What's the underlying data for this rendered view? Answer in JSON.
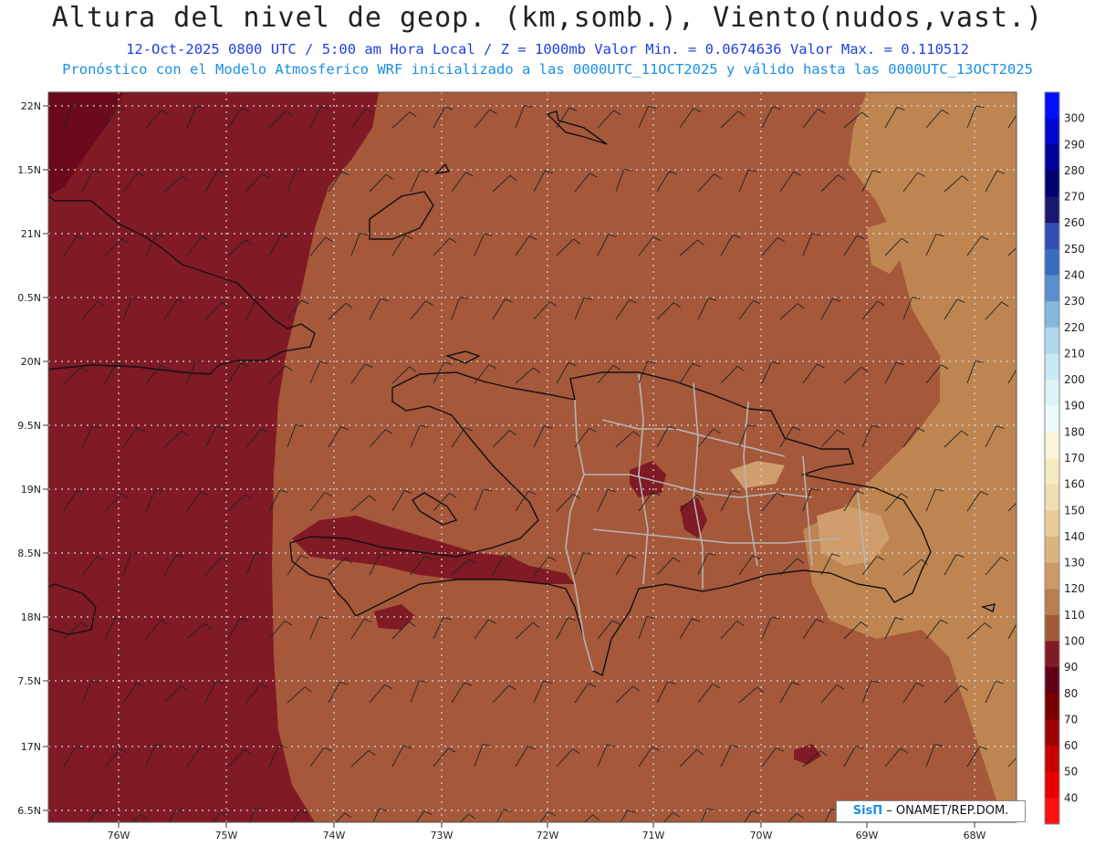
{
  "title": "Altura del nivel de geop. (km,somb.), Viento(nudos,vast.)",
  "subtitle1": "12-Oct-2025  0800 UTC / 5:00 am Hora Local / Z = 1000mb  Valor Min. = 0.0674636  Valor Max. = 0.110512",
  "subtitle2": "Pronóstico con el Modelo Atmosferico WRF inicializado a las 0000UTC_11OCT2025 y válido hasta las  0000UTC_13OCT2025",
  "credit": {
    "brand": "SisΠ",
    "org": " – ONAMET/REP.DOM."
  },
  "lat_labels": [
    "22N",
    "1.5N",
    "21N",
    "0.5N",
    "20N",
    "9.5N",
    "19N",
    "8.5N",
    "18N",
    "7.5N",
    "17N",
    "6.5N"
  ],
  "lon_labels": [
    "76W",
    "75W",
    "74W",
    "73W",
    "72W",
    "71W",
    "70W",
    "69W",
    "68W"
  ],
  "colorbar": {
    "labels": [
      "300",
      "290",
      "280",
      "270",
      "260",
      "250",
      "240",
      "230",
      "220",
      "210",
      "200",
      "190",
      "180",
      "170",
      "160",
      "150",
      "140",
      "130",
      "120",
      "110",
      "100",
      "90",
      "80",
      "70",
      "60",
      "50",
      "40"
    ],
    "colors": [
      "#0010ff",
      "#0008d0",
      "#00009a",
      "#000070",
      "#1a1870",
      "#2f4fb0",
      "#3a6cc0",
      "#5a8fcb",
      "#86b8de",
      "#aed8ec",
      "#c8eaf4",
      "#ddf3f8",
      "#eefafc",
      "#fcf6d8",
      "#f6ebc0",
      "#f0deb0",
      "#e8cc98",
      "#dcb480",
      "#cc9a68",
      "#b87f52",
      "#a05a3a",
      "#801a24",
      "#600018",
      "#7a0000",
      "#a00000",
      "#c80000",
      "#e80000",
      "#ff1010"
    ]
  },
  "colors": {
    "c90": "#801a24",
    "c100": "#a5583a",
    "c110": "#bf8550",
    "c120": "#cf9e6c"
  },
  "wind_barbs": "wind-barb-field"
}
